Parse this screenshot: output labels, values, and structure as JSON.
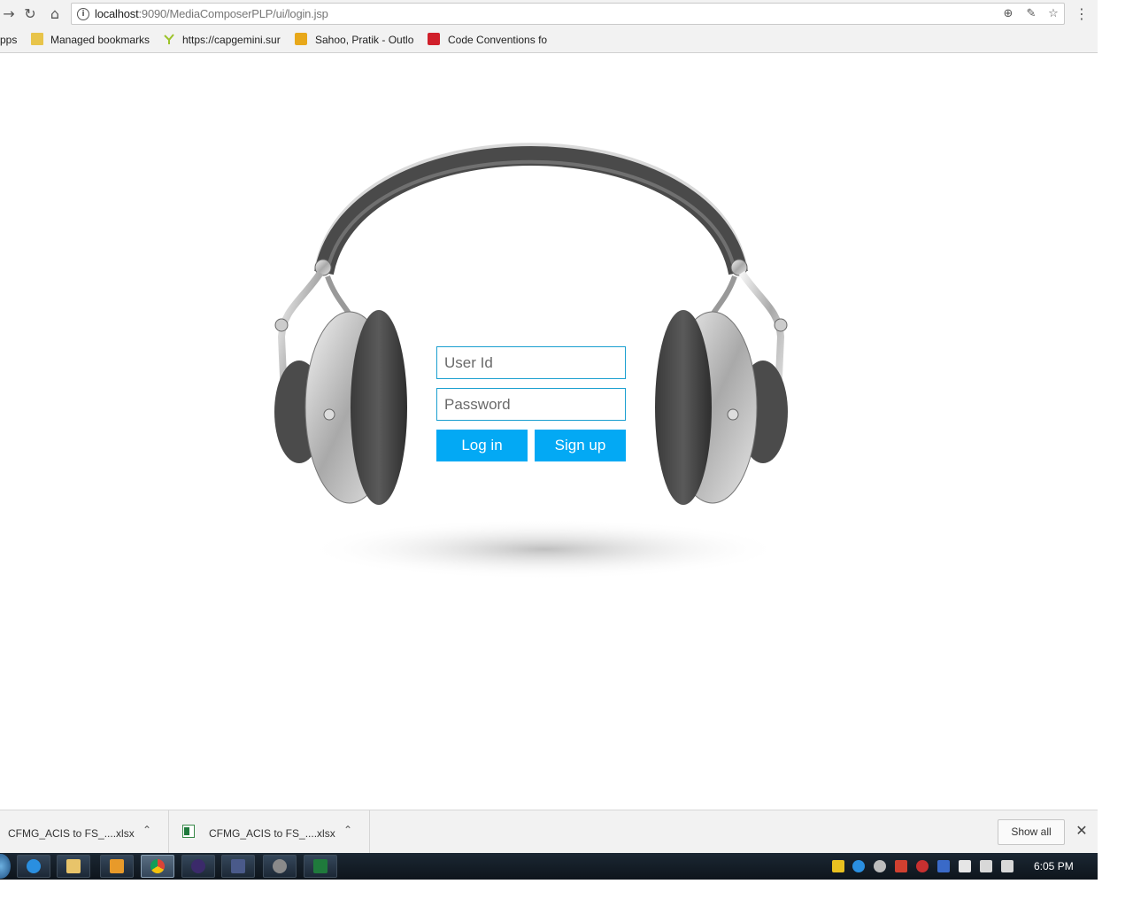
{
  "browser": {
    "url_host": "localhost",
    "url_rest": ":9090/MediaComposerPLP/ui/login.jsp",
    "bookmarks": [
      {
        "label": "pps",
        "icon": "apps-icon"
      },
      {
        "label": "Managed bookmarks",
        "icon": "folder-icon"
      },
      {
        "label": "https://capgemini.sur",
        "icon": "capgemini-icon"
      },
      {
        "label": "Sahoo, Pratik - Outlo",
        "icon": "outlook-icon"
      },
      {
        "label": "Code Conventions fo",
        "icon": "oracle-icon"
      }
    ]
  },
  "login": {
    "user_placeholder": "User Id",
    "password_placeholder": "Password",
    "login_label": "Log in",
    "signup_label": "Sign up"
  },
  "downloads": {
    "items": [
      {
        "name": "CFMG_ACIS to FS_....xlsx"
      },
      {
        "name": "CFMG_ACIS to FS_....xlsx"
      }
    ],
    "show_all": "Show all"
  },
  "taskbar": {
    "clock": "6:05 PM"
  },
  "colors": {
    "accent": "#03a9f4",
    "field_border": "#1a9fd0"
  }
}
